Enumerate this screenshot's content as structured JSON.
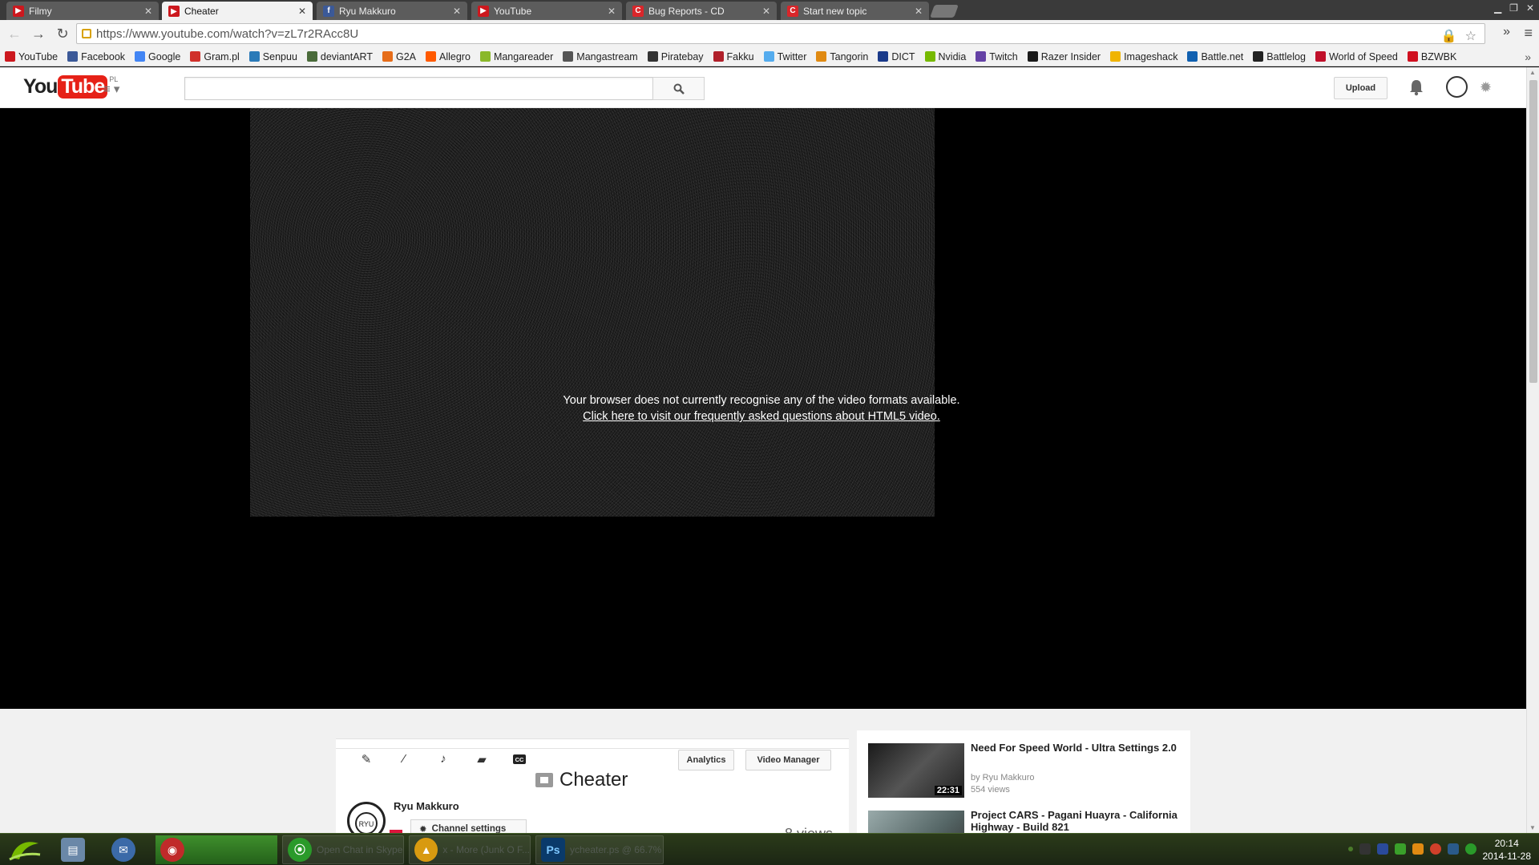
{
  "browser": {
    "tabs": [
      {
        "label": "Filmy",
        "icon": "youtube-icon",
        "color": "#cc181e"
      },
      {
        "label": "Cheater",
        "icon": "youtube-icon",
        "color": "#cc181e"
      },
      {
        "label": "Ryu Makkuro",
        "icon": "facebook-icon",
        "color": "#3b5998"
      },
      {
        "label": "YouTube",
        "icon": "youtube-icon",
        "color": "#cc181e"
      },
      {
        "label": "Bug Reports - CD",
        "icon": "c-icon",
        "color": "#d9262a"
      },
      {
        "label": "Start new topic",
        "icon": "c-icon",
        "color": "#d9262a"
      }
    ],
    "active_tab_index": 1,
    "url": "https://www.youtube.com/watch?v=zL7r2RAcc8U",
    "bookmarks": [
      {
        "label": "YouTube",
        "color": "#cc181e"
      },
      {
        "label": "Facebook",
        "color": "#3b5998"
      },
      {
        "label": "Google",
        "color": "#4285f4"
      },
      {
        "label": "Gram.pl",
        "color": "#d0302a"
      },
      {
        "label": "Senpuu",
        "color": "#2a7ab8"
      },
      {
        "label": "deviantART",
        "color": "#4a6b3a"
      },
      {
        "label": "G2A",
        "color": "#e66d1a"
      },
      {
        "label": "Allegro",
        "color": "#ff5a00"
      },
      {
        "label": "Mangareader",
        "color": "#8ab82a"
      },
      {
        "label": "Mangastream",
        "color": "#555555"
      },
      {
        "label": "Piratebay",
        "color": "#333333"
      },
      {
        "label": "Fakku",
        "color": "#b0202a"
      },
      {
        "label": "Twitter",
        "color": "#55acee"
      },
      {
        "label": "Tangorin",
        "color": "#e08a12"
      },
      {
        "label": "DICT",
        "color": "#1a3a8a"
      },
      {
        "label": "Nvidia",
        "color": "#76b900"
      },
      {
        "label": "Twitch",
        "color": "#6441a5"
      },
      {
        "label": "Razer Insider",
        "color": "#1a1a1a"
      },
      {
        "label": "Imageshack",
        "color": "#f0b400"
      },
      {
        "label": "Battle.net",
        "color": "#1060b0"
      },
      {
        "label": "Battlelog",
        "color": "#222222"
      },
      {
        "label": "World of Speed",
        "color": "#c0102a"
      },
      {
        "label": "BZWBK",
        "color": "#d01020"
      }
    ]
  },
  "youtube": {
    "country": "PL",
    "search_placeholder": "",
    "upload_label": "Upload",
    "player": {
      "message": "Your browser does not currently recognise any of the video formats available.",
      "faq_link": "Click here to visit our frequently asked questions about HTML5 video."
    },
    "creator_bar": {
      "analytics_label": "Analytics",
      "video_manager_label": "Video Manager"
    },
    "video": {
      "title": "Cheater",
      "owner": "Ryu Makkuro",
      "channel_settings_label": "Channel settings",
      "views": "8 views"
    },
    "related": [
      {
        "title": "Need For Speed World - Ultra Settings 2.0",
        "by": "by Ryu Makkuro",
        "views": "554 views",
        "duration": "22:31"
      },
      {
        "title": "Project CARS - Pagani Huayra - California Highway - Build 821",
        "by": "",
        "views": "",
        "duration": ""
      }
    ]
  },
  "taskbar": {
    "items": [
      {
        "label": "",
        "icon": "explorer-icon",
        "color": "#6a88a8"
      },
      {
        "label": "",
        "icon": "thunderbird-icon",
        "color": "#3b6aa8"
      },
      {
        "label": "",
        "icon": "chrome-icon",
        "color": "#c02a2a"
      },
      {
        "label": "Open Chat in Skype",
        "icon": "game-icon",
        "color": "#2a9a2a"
      },
      {
        "label": "x - More (Junk O F...",
        "icon": "aimp-icon",
        "color": "#d89a10"
      },
      {
        "label": "ycheater.ps @ 66.7%",
        "icon": "photoshop-icon",
        "color": "#0a3a6a"
      }
    ],
    "time": "20:14",
    "date": "2014-11-28"
  }
}
